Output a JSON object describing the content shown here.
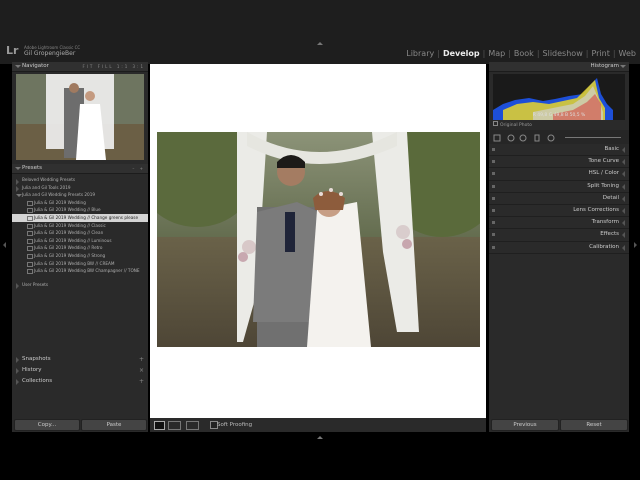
{
  "app": {
    "logo": "Lr",
    "product": "Adobe Lightroom Classic CC",
    "user": "Gil GropengieBer"
  },
  "modules": [
    {
      "label": "Library",
      "active": false
    },
    {
      "label": "Develop",
      "active": true
    },
    {
      "label": "Map",
      "active": false
    },
    {
      "label": "Book",
      "active": false
    },
    {
      "label": "Slideshow",
      "active": false
    },
    {
      "label": "Print",
      "active": false
    },
    {
      "label": "Web",
      "active": false
    }
  ],
  "left_panel": {
    "navigator": {
      "title": "Navigator",
      "zoom_options": "FIT FILL 1:1 3:1"
    },
    "presets": {
      "title": "Presets",
      "header_actions": "– +",
      "folders": [
        {
          "label": "Beloved Wedding Presets",
          "expanded": false
        },
        {
          "label": "Julia and Gil Tools 2019",
          "expanded": false
        },
        {
          "label": "Julia and Gil Wedding Presets 2019",
          "expanded": true
        }
      ],
      "items": [
        {
          "label": "Julia & Gil 2019 Wedding",
          "selected": false
        },
        {
          "label": "Julia & Gil 2019 Wedding // Blue",
          "selected": false
        },
        {
          "label": "Julia & Gil 2019 Wedding // Change greens please",
          "selected": true
        },
        {
          "label": "Julia & Gil 2019 Wedding // Classic",
          "selected": false
        },
        {
          "label": "Julia & Gil 2019 Wedding // Clean",
          "selected": false
        },
        {
          "label": "Julia & Gil 2019 Wedding // Luminous",
          "selected": false
        },
        {
          "label": "Julia & Gil 2019 Wedding // Retro",
          "selected": false
        },
        {
          "label": "Julia & Gil 2019 Wedding // Strong",
          "selected": false
        },
        {
          "label": "Julia & Gil 2019 Wedding BW // CREAM",
          "selected": false
        },
        {
          "label": "Julia & Gil 2019 Wedding BW Champagner // TONE",
          "selected": false
        }
      ],
      "user_presets": "User Presets"
    },
    "sections": [
      {
        "label": "Snapshots",
        "plus": "+"
      },
      {
        "label": "History",
        "plus": "×"
      },
      {
        "label": "Collections",
        "plus": "+"
      }
    ],
    "copy_label": "Copy...",
    "paste_label": "Paste"
  },
  "toolbar": {
    "soft_proofing_label": "Soft Proofing",
    "view_modes": [
      "loupe",
      "before-after",
      "before-after-split"
    ]
  },
  "right_panel": {
    "histogram": {
      "title": "Histogram",
      "readout": "R 49,8  G 49,8  B 50,5 %",
      "original_photo": "Original Photo"
    },
    "sections": [
      {
        "label": "Basic"
      },
      {
        "label": "Tone Curve"
      },
      {
        "label": "HSL / Color"
      },
      {
        "label": "Split Toning"
      },
      {
        "label": "Detail"
      },
      {
        "label": "Lens Corrections"
      },
      {
        "label": "Transform"
      },
      {
        "label": "Effects"
      },
      {
        "label": "Calibration"
      }
    ],
    "previous_label": "Previous",
    "reset_label": "Reset"
  },
  "colors": {
    "panel": "#2a2a2a",
    "selected_row": "#d4d4d4",
    "active_module": "#eeeeee"
  }
}
